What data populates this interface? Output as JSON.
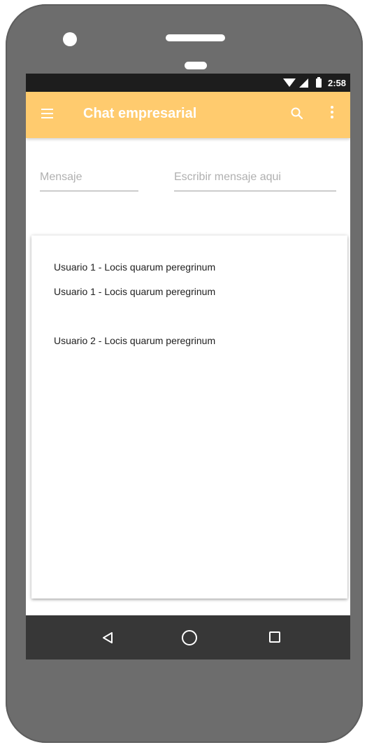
{
  "status_bar": {
    "time": "2:58",
    "icons": [
      "wifi-icon",
      "signal-icon",
      "battery-icon"
    ]
  },
  "app_bar": {
    "title": "Chat empresarial",
    "menu_icon": "menu-icon",
    "search_icon": "search-icon",
    "more_icon": "more-vert-icon",
    "color": "#ffcb6e"
  },
  "form": {
    "mensaje_placeholder": "Mensaje",
    "mensaje_value": "",
    "escribir_placeholder": "Escribir mensaje aqui",
    "escribir_value": ""
  },
  "chat": {
    "messages": [
      {
        "text": "Usuario 1 - Locis quarum peregrinum"
      },
      {
        "text": "Usuario 1 - Locis quarum peregrinum"
      },
      {
        "text": "Usuario 2 - Locis quarum peregrinum"
      }
    ]
  },
  "nav_bar": {
    "icons": [
      "back-icon",
      "home-icon",
      "recent-apps-icon"
    ]
  },
  "colors": {
    "phone_body": "#6d6d6d",
    "status_bar": "#1d1d1d",
    "nav_bar": "#373737",
    "accent": "#ffcb6e"
  }
}
